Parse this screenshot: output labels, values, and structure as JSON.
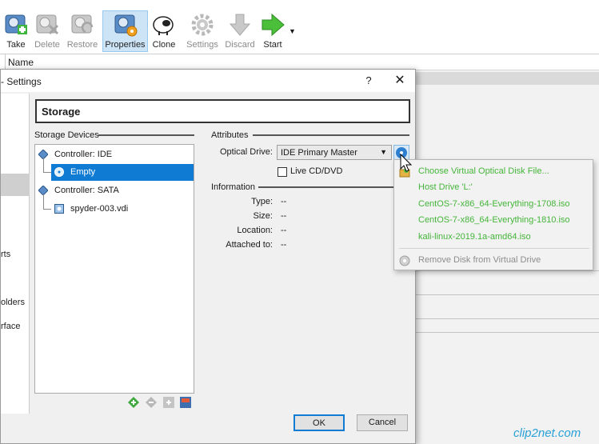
{
  "toolbar": {
    "buttons": [
      {
        "label": "Take",
        "enabled": true
      },
      {
        "label": "Delete",
        "enabled": false
      },
      {
        "label": "Restore",
        "enabled": false
      },
      {
        "label": "Properties",
        "enabled": true,
        "active": true
      },
      {
        "label": "Clone",
        "enabled": true
      },
      {
        "label": "Settings",
        "enabled": false
      },
      {
        "label": "Discard",
        "enabled": false
      },
      {
        "label": "Start",
        "enabled": true
      }
    ]
  },
  "list_header": {
    "name_label": "Name"
  },
  "background_left_fragments": [
    "rts",
    "olders",
    "rface"
  ],
  "dialog": {
    "title": "- Settings",
    "help_label": "?",
    "close_label": "✕",
    "page_title": "Storage",
    "storage_devices_label": "Storage Devices",
    "tree": [
      {
        "type": "controller",
        "label": "Controller: IDE"
      },
      {
        "type": "disk",
        "label": "Empty",
        "selected": true
      },
      {
        "type": "controller",
        "label": "Controller: SATA"
      },
      {
        "type": "disk",
        "label": "spyder-003.vdi",
        "selected": false
      }
    ],
    "attributes_label": "Attributes",
    "optical_drive_label": "Optical Drive:",
    "optical_drive_value": "IDE Primary Master",
    "live_cd_label": "Live CD/DVD",
    "live_cd_checked": false,
    "information_label": "Information",
    "info": [
      {
        "label": "Type:",
        "value": "--"
      },
      {
        "label": "Size:",
        "value": "--"
      },
      {
        "label": "Location:",
        "value": "--"
      },
      {
        "label": "Attached to:",
        "value": "--"
      }
    ],
    "ok_label": "OK",
    "cancel_label": "Cancel"
  },
  "popup_menu": {
    "items": [
      {
        "label": "Choose Virtual Optical Disk File...",
        "enabled": true
      },
      {
        "label": "Host Drive 'L:'",
        "enabled": true
      },
      {
        "label": "CentOS-7-x86_64-Everything-1708.iso",
        "enabled": true
      },
      {
        "label": "CentOS-7-x86_64-Everything-1810.iso",
        "enabled": true
      },
      {
        "label": "kali-linux-2019.1a-amd64.iso",
        "enabled": true
      },
      {
        "label": "Remove Disk from Virtual Drive",
        "enabled": false
      }
    ]
  },
  "watermark": "clip2net.com",
  "colors": {
    "menu_text": "#45b53a",
    "selection": "#0f7bd3",
    "menu_disabled": "#8d8d8d"
  }
}
